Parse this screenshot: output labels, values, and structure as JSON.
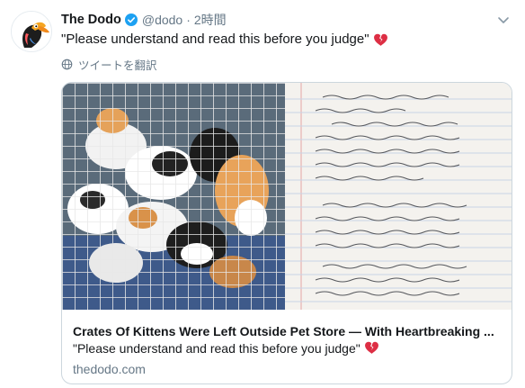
{
  "tweet": {
    "author_name": "The Dodo",
    "handle": "@dodo",
    "separator": "·",
    "time": "2時間",
    "text": "\"Please understand and read this before you judge\"",
    "translate_label": "ツイートを翻訳",
    "icons": {
      "avatar": "dodo-bird-logo",
      "verified": "verified-badge-icon",
      "menu": "chevron-down-icon",
      "emoji": "broken-heart-icon",
      "translate": "globe-icon"
    }
  },
  "card": {
    "image_description_icon": "kittens-crate-and-handwritten-note-image",
    "title": "Crates Of Kittens Were Left Outside Pet Store — With Heartbreaking ...",
    "description": "\"Please understand and read this before you judge\"",
    "domain": "thedodo.com"
  },
  "colors": {
    "text_primary": "#14171a",
    "text_secondary": "#657786",
    "verified_blue": "#1da1f2",
    "heart_red": "#dd2e44",
    "border": "#ccd6dd"
  }
}
